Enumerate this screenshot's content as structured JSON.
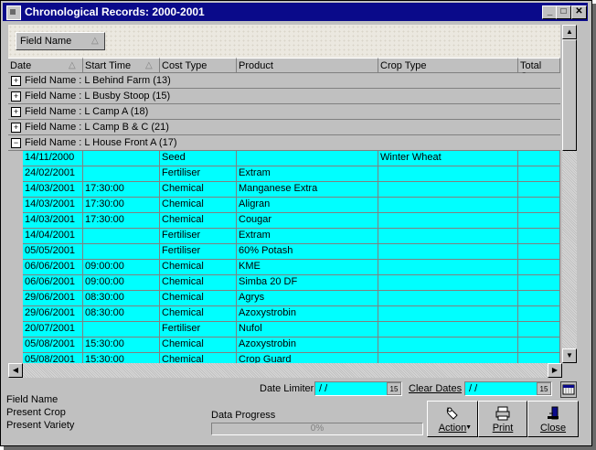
{
  "window": {
    "title": "Chronological Records: 2000-2001",
    "min": "_",
    "max": "□",
    "close": "✕"
  },
  "group_button": {
    "label": "Field Name",
    "sort": "△"
  },
  "columns": [
    {
      "label": "Date",
      "sort": "△"
    },
    {
      "label": "Start Time",
      "sort": "△"
    },
    {
      "label": "Cost Type",
      "sort": ""
    },
    {
      "label": "Product",
      "sort": ""
    },
    {
      "label": "Crop Type",
      "sort": ""
    },
    {
      "label": "Total Cos",
      "sort": ""
    }
  ],
  "groups": [
    {
      "expander": "+",
      "label": "Field Name : L Behind Farm  (13)"
    },
    {
      "expander": "+",
      "label": "Field Name : L Busby Stoop  (15)"
    },
    {
      "expander": "+",
      "label": "Field Name : L Camp A  (18)"
    },
    {
      "expander": "+",
      "label": "Field Name : L Camp B & C  (21)"
    },
    {
      "expander": "−",
      "label": "Field Name : L House Front A  (17)"
    }
  ],
  "rows": [
    [
      "14/11/2000",
      "",
      "Seed",
      "",
      "Winter Wheat"
    ],
    [
      "24/02/2001",
      "",
      "Fertiliser",
      "Extram",
      ""
    ],
    [
      "14/03/2001",
      "17:30:00",
      "Chemical",
      "Manganese Extra",
      ""
    ],
    [
      "14/03/2001",
      "17:30:00",
      "Chemical",
      "Aligran",
      ""
    ],
    [
      "14/03/2001",
      "17:30:00",
      "Chemical",
      "Cougar",
      ""
    ],
    [
      "14/04/2001",
      "",
      "Fertiliser",
      "Extram",
      ""
    ],
    [
      "05/05/2001",
      "",
      "Fertiliser",
      "60% Potash",
      ""
    ],
    [
      "06/06/2001",
      "09:00:00",
      "Chemical",
      "KME",
      ""
    ],
    [
      "06/06/2001",
      "09:00:00",
      "Chemical",
      "Simba 20 DF",
      ""
    ],
    [
      "29/06/2001",
      "08:30:00",
      "Chemical",
      "Agrys",
      ""
    ],
    [
      "29/06/2001",
      "08:30:00",
      "Chemical",
      "Azoxystrobin",
      ""
    ],
    [
      "20/07/2001",
      "",
      "Fertiliser",
      "Nufol",
      ""
    ],
    [
      "05/08/2001",
      "15:30:00",
      "Chemical",
      "Azoxystrobin",
      ""
    ],
    [
      "05/08/2001",
      "15:30:00",
      "Chemical",
      "Crop Guard",
      ""
    ]
  ],
  "bottom": {
    "date_limiter_label": "Date Limiter",
    "date_limiter_value": " /  /",
    "clear_dates_label": "Clear Dates",
    "clear_dates_value": " /  /",
    "cal_icon_text": "15",
    "info_field": "Field Name",
    "info_crop": "Present Crop",
    "info_variety": "Present Variety",
    "progress_label": "Data Progress",
    "progress_text": "0%",
    "progress_fraction": 0
  },
  "actions": {
    "action": "Action",
    "print": "Print",
    "close": "Close"
  }
}
